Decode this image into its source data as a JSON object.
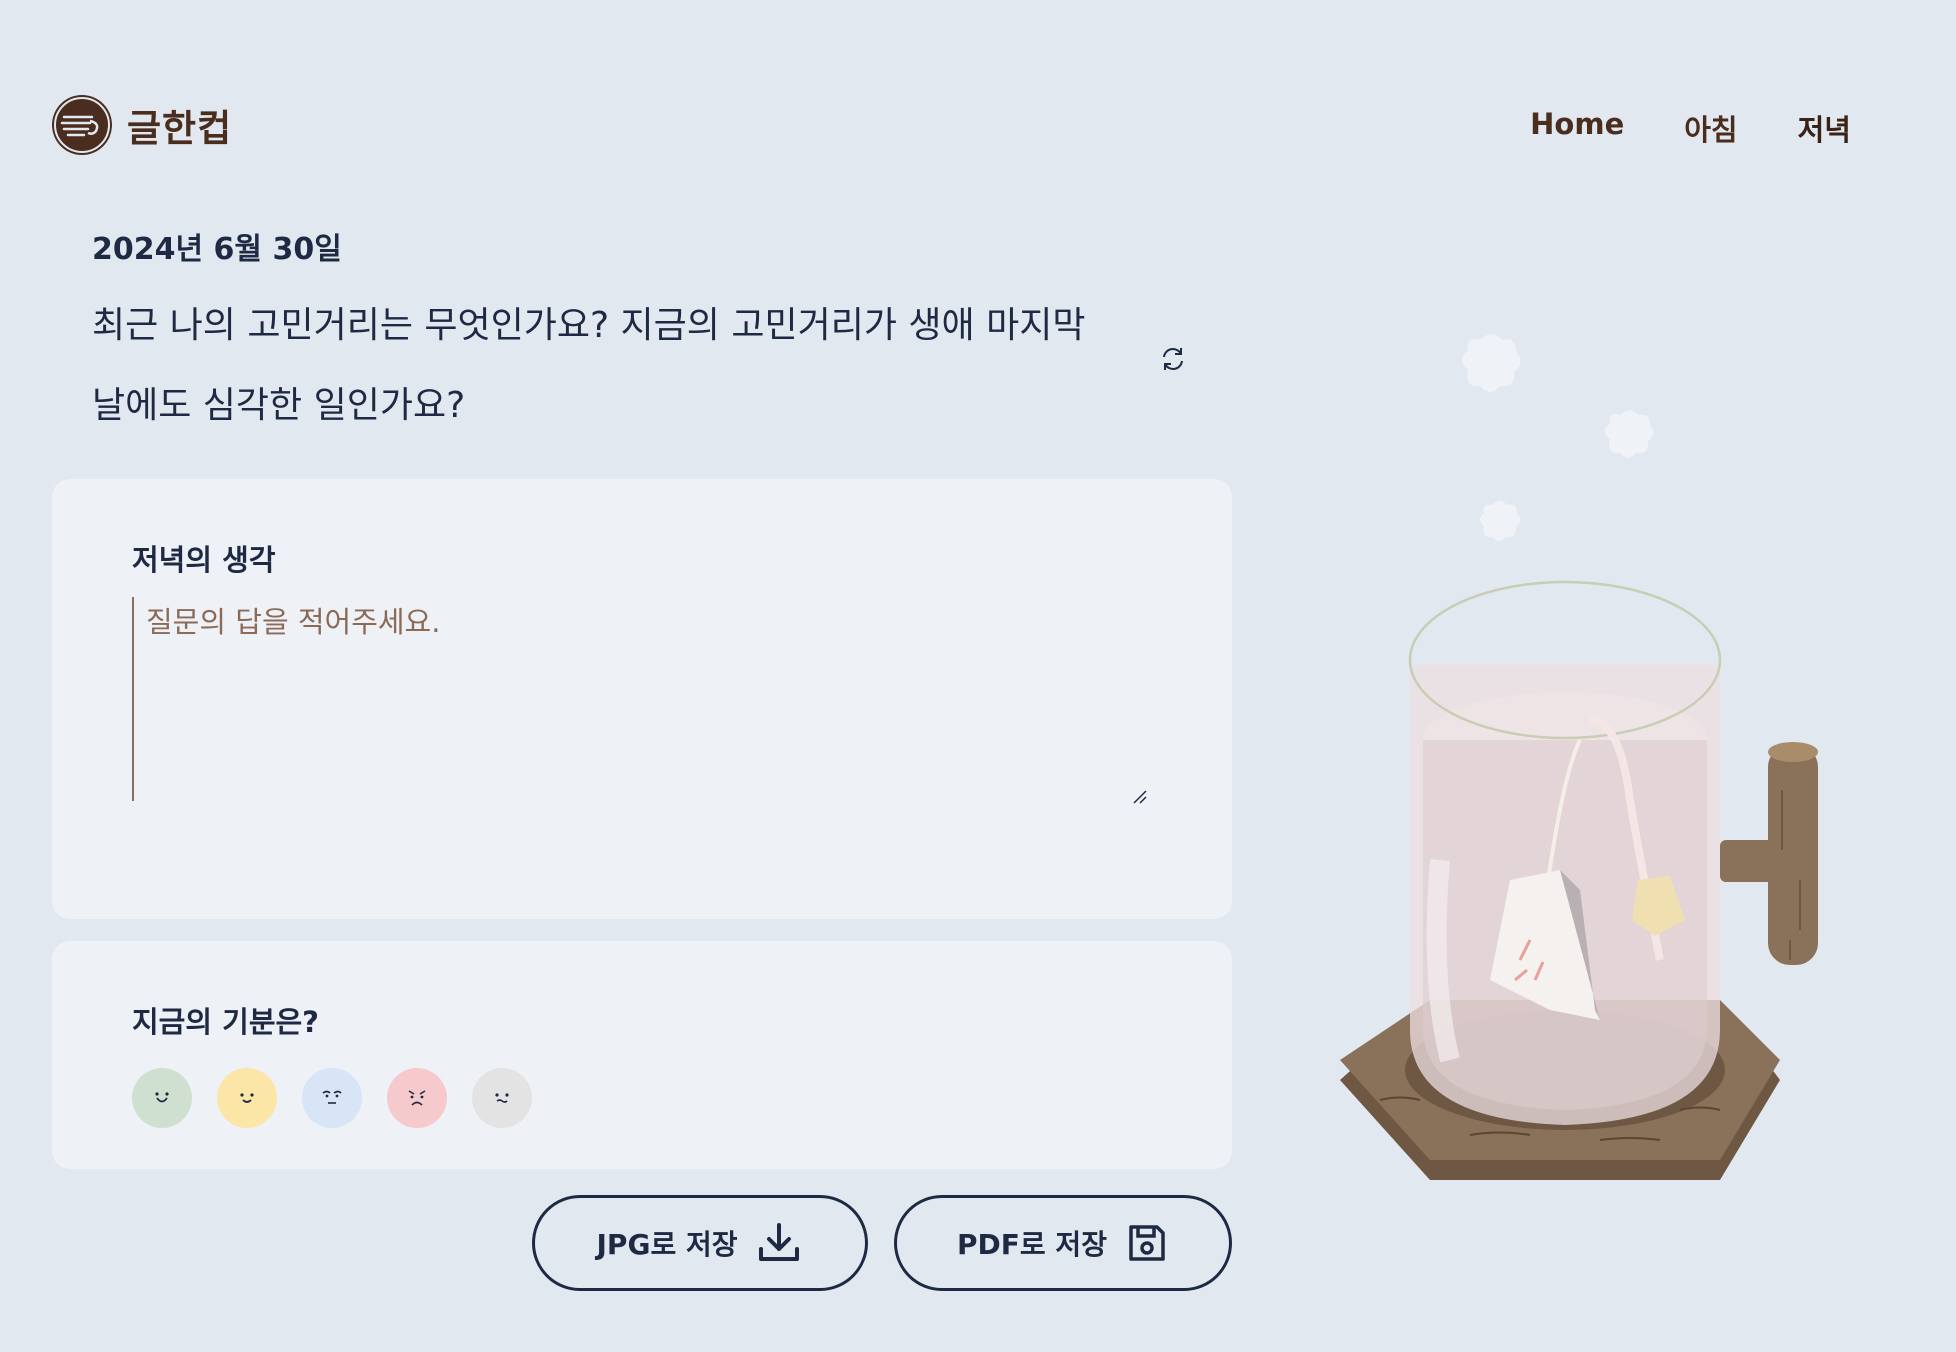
{
  "header": {
    "logo_text": "글한컵",
    "nav": [
      {
        "label": "Home"
      },
      {
        "label": "아침"
      },
      {
        "label": "저녁"
      }
    ]
  },
  "question": {
    "date": "2024년 6월 30일",
    "line1": "최근 나의 고민거리는 무엇인가요? 지금의 고민거리가 생애 마지막",
    "line2": "날에도 심각한 일인가요?"
  },
  "answer": {
    "title": "저녁의 생각",
    "value": "",
    "placeholder": "질문의 답을 적어주세요."
  },
  "mood": {
    "title": "지금의 기분은?",
    "options": [
      {
        "icon": "happy-face-icon",
        "color": "#cfdfd0"
      },
      {
        "icon": "smile-face-icon",
        "color": "#fbe6a8"
      },
      {
        "icon": "sad-face-icon",
        "color": "#d8e5f6"
      },
      {
        "icon": "angry-face-icon",
        "color": "#f6cacc"
      },
      {
        "icon": "neutral-face-icon",
        "color": "#e3e3e3"
      }
    ]
  },
  "actions": {
    "jpg_label": "JPG로 저장",
    "pdf_label": "PDF로 저장"
  },
  "colors": {
    "background": "#e1e8ef",
    "card": "#eef2f7",
    "navy": "#1e2a44",
    "brown": "#4a2d1f"
  }
}
